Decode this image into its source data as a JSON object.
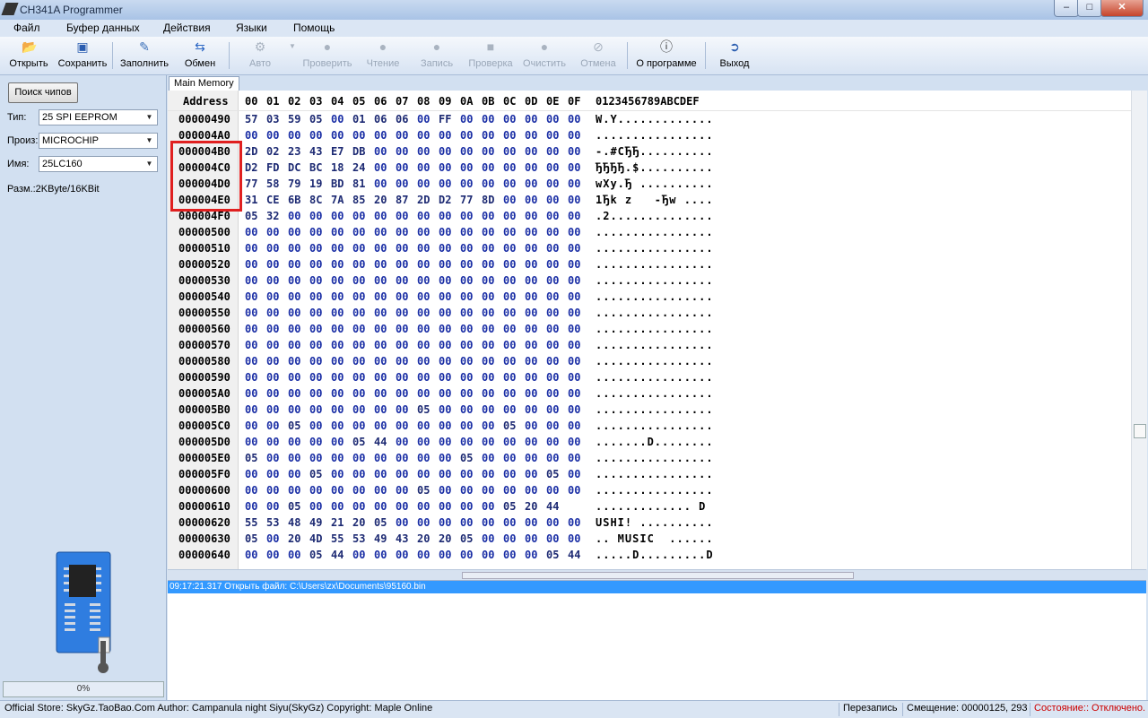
{
  "window": {
    "title": "CH341A Programmer",
    "btn_min": "–",
    "btn_max": "□",
    "btn_close": "✕"
  },
  "menu": [
    "Файл",
    "Буфер данных",
    "Действия",
    "Языки",
    "Помощь"
  ],
  "toolbar": [
    {
      "label": "Открыть",
      "icon": "open-folder-icon",
      "enabled": true
    },
    {
      "label": "Сохранить",
      "icon": "save-disk-icon",
      "enabled": true
    },
    {
      "label": "Заполнить",
      "icon": "fill-icon",
      "enabled": true
    },
    {
      "label": "Обмен",
      "icon": "swap-arrows-icon",
      "enabled": true
    },
    {
      "label": "Авто",
      "icon": "auto-icon",
      "enabled": false
    },
    {
      "label": "Проверить",
      "icon": "verify-icon",
      "enabled": false
    },
    {
      "label": "Чтение",
      "icon": "read-icon",
      "enabled": false
    },
    {
      "label": "Запись",
      "icon": "write-icon",
      "enabled": false
    },
    {
      "label": "Проверка",
      "icon": "check-icon",
      "enabled": false
    },
    {
      "label": "Очистить",
      "icon": "erase-icon",
      "enabled": false
    },
    {
      "label": "Отмена",
      "icon": "cancel-icon",
      "enabled": false
    },
    {
      "label": "О программе",
      "icon": "info-icon",
      "enabled": true
    },
    {
      "label": "Выход",
      "icon": "exit-icon",
      "enabled": true
    }
  ],
  "left": {
    "search_button": "Поиск чипов",
    "type_label": "Тип:",
    "type_value": "25 SPI EEPROM",
    "vendor_label": "Произ:",
    "vendor_value": "MICROCHIP",
    "name_label": "Имя:",
    "name_value": "25LC160",
    "size_text": "Разм.:2KByte/16KBit",
    "progress_text": "0%",
    "progress_fraction": 0
  },
  "hex": {
    "tab_label": "Main Memory",
    "header_address": "Address",
    "header_cols": [
      "00",
      "01",
      "02",
      "03",
      "04",
      "05",
      "06",
      "07",
      "08",
      "09",
      "0A",
      "0B",
      "0C",
      "0D",
      "0E",
      "0F"
    ],
    "header_ascii": "0123456789ABCDEF",
    "rows": [
      {
        "addr": "00000490",
        "bytes": [
          "57",
          "03",
          "59",
          "05",
          "00",
          "01",
          "06",
          "06",
          "00",
          "FF",
          "00",
          "00",
          "00",
          "00",
          "00",
          "00"
        ],
        "ascii": "W.Y............."
      },
      {
        "addr": "000004A0",
        "bytes": [
          "00",
          "00",
          "00",
          "00",
          "00",
          "00",
          "00",
          "00",
          "00",
          "00",
          "00",
          "00",
          "00",
          "00",
          "00",
          "00"
        ],
        "ascii": "................"
      },
      {
        "addr": "000004B0",
        "bytes": [
          "2D",
          "02",
          "23",
          "43",
          "E7",
          "DB",
          "00",
          "00",
          "00",
          "00",
          "00",
          "00",
          "00",
          "00",
          "00",
          "00"
        ],
        "ascii": "-.#CЂЂ.........."
      },
      {
        "addr": "000004C0",
        "bytes": [
          "D2",
          "FD",
          "DC",
          "BC",
          "18",
          "24",
          "00",
          "00",
          "00",
          "00",
          "00",
          "00",
          "00",
          "00",
          "00",
          "00"
        ],
        "ascii": "ЂЂЂЂ.$.........."
      },
      {
        "addr": "000004D0",
        "bytes": [
          "77",
          "58",
          "79",
          "19",
          "BD",
          "81",
          "00",
          "00",
          "00",
          "00",
          "00",
          "00",
          "00",
          "00",
          "00",
          "00"
        ],
        "ascii": "wXy.Ђ .........."
      },
      {
        "addr": "000004E0",
        "bytes": [
          "31",
          "CE",
          "6B",
          "8C",
          "7A",
          "85",
          "20",
          "87",
          "2D",
          "D2",
          "77",
          "8D",
          "00",
          "00",
          "00",
          "00"
        ],
        "ascii": "1Ђk z   -Ђw ...."
      },
      {
        "addr": "000004F0",
        "bytes": [
          "05",
          "32",
          "00",
          "00",
          "00",
          "00",
          "00",
          "00",
          "00",
          "00",
          "00",
          "00",
          "00",
          "00",
          "00",
          "00"
        ],
        "ascii": ".2.............."
      },
      {
        "addr": "00000500",
        "bytes": [
          "00",
          "00",
          "00",
          "00",
          "00",
          "00",
          "00",
          "00",
          "00",
          "00",
          "00",
          "00",
          "00",
          "00",
          "00",
          "00"
        ],
        "ascii": "................"
      },
      {
        "addr": "00000510",
        "bytes": [
          "00",
          "00",
          "00",
          "00",
          "00",
          "00",
          "00",
          "00",
          "00",
          "00",
          "00",
          "00",
          "00",
          "00",
          "00",
          "00"
        ],
        "ascii": "................"
      },
      {
        "addr": "00000520",
        "bytes": [
          "00",
          "00",
          "00",
          "00",
          "00",
          "00",
          "00",
          "00",
          "00",
          "00",
          "00",
          "00",
          "00",
          "00",
          "00",
          "00"
        ],
        "ascii": "................"
      },
      {
        "addr": "00000530",
        "bytes": [
          "00",
          "00",
          "00",
          "00",
          "00",
          "00",
          "00",
          "00",
          "00",
          "00",
          "00",
          "00",
          "00",
          "00",
          "00",
          "00"
        ],
        "ascii": "................"
      },
      {
        "addr": "00000540",
        "bytes": [
          "00",
          "00",
          "00",
          "00",
          "00",
          "00",
          "00",
          "00",
          "00",
          "00",
          "00",
          "00",
          "00",
          "00",
          "00",
          "00"
        ],
        "ascii": "................"
      },
      {
        "addr": "00000550",
        "bytes": [
          "00",
          "00",
          "00",
          "00",
          "00",
          "00",
          "00",
          "00",
          "00",
          "00",
          "00",
          "00",
          "00",
          "00",
          "00",
          "00"
        ],
        "ascii": "................"
      },
      {
        "addr": "00000560",
        "bytes": [
          "00",
          "00",
          "00",
          "00",
          "00",
          "00",
          "00",
          "00",
          "00",
          "00",
          "00",
          "00",
          "00",
          "00",
          "00",
          "00"
        ],
        "ascii": "................"
      },
      {
        "addr": "00000570",
        "bytes": [
          "00",
          "00",
          "00",
          "00",
          "00",
          "00",
          "00",
          "00",
          "00",
          "00",
          "00",
          "00",
          "00",
          "00",
          "00",
          "00"
        ],
        "ascii": "................"
      },
      {
        "addr": "00000580",
        "bytes": [
          "00",
          "00",
          "00",
          "00",
          "00",
          "00",
          "00",
          "00",
          "00",
          "00",
          "00",
          "00",
          "00",
          "00",
          "00",
          "00"
        ],
        "ascii": "................"
      },
      {
        "addr": "00000590",
        "bytes": [
          "00",
          "00",
          "00",
          "00",
          "00",
          "00",
          "00",
          "00",
          "00",
          "00",
          "00",
          "00",
          "00",
          "00",
          "00",
          "00"
        ],
        "ascii": "................"
      },
      {
        "addr": "000005A0",
        "bytes": [
          "00",
          "00",
          "00",
          "00",
          "00",
          "00",
          "00",
          "00",
          "00",
          "00",
          "00",
          "00",
          "00",
          "00",
          "00",
          "00"
        ],
        "ascii": "................"
      },
      {
        "addr": "000005B0",
        "bytes": [
          "00",
          "00",
          "00",
          "00",
          "00",
          "00",
          "00",
          "00",
          "05",
          "00",
          "00",
          "00",
          "00",
          "00",
          "00",
          "00"
        ],
        "ascii": "................"
      },
      {
        "addr": "000005C0",
        "bytes": [
          "00",
          "00",
          "05",
          "00",
          "00",
          "00",
          "00",
          "00",
          "00",
          "00",
          "00",
          "00",
          "05",
          "00",
          "00",
          "00"
        ],
        "ascii": "................"
      },
      {
        "addr": "000005D0",
        "bytes": [
          "00",
          "00",
          "00",
          "00",
          "00",
          "05",
          "44",
          "00",
          "00",
          "00",
          "00",
          "00",
          "00",
          "00",
          "00",
          "00"
        ],
        "ascii": ".......D........"
      },
      {
        "addr": "000005E0",
        "bytes": [
          "05",
          "00",
          "00",
          "00",
          "00",
          "00",
          "00",
          "00",
          "00",
          "00",
          "05",
          "00",
          "00",
          "00",
          "00",
          "00"
        ],
        "ascii": "................"
      },
      {
        "addr": "000005F0",
        "bytes": [
          "00",
          "00",
          "00",
          "05",
          "00",
          "00",
          "00",
          "00",
          "00",
          "00",
          "00",
          "00",
          "00",
          "00",
          "05",
          "00"
        ],
        "ascii": "................"
      },
      {
        "addr": "00000600",
        "bytes": [
          "00",
          "00",
          "00",
          "00",
          "00",
          "00",
          "00",
          "00",
          "05",
          "00",
          "00",
          "00",
          "00",
          "00",
          "00",
          "00"
        ],
        "ascii": "................"
      },
      {
        "addr": "00000610",
        "bytes": [
          "00",
          "00",
          "05",
          "00",
          "00",
          "00",
          "00",
          "00",
          "00",
          "00",
          "00",
          "00",
          "05",
          "20",
          "44"
        ],
        "ascii": "............. D"
      },
      {
        "addr": "00000620",
        "bytes": [
          "55",
          "53",
          "48",
          "49",
          "21",
          "20",
          "05",
          "00",
          "00",
          "00",
          "00",
          "00",
          "00",
          "00",
          "00",
          "00"
        ],
        "ascii": "USHI! .........."
      },
      {
        "addr": "00000630",
        "bytes": [
          "05",
          "00",
          "20",
          "4D",
          "55",
          "53",
          "49",
          "43",
          "20",
          "20",
          "05",
          "00",
          "00",
          "00",
          "00",
          "00"
        ],
        "ascii": ".. MUSIC  ......"
      },
      {
        "addr": "00000640",
        "bytes": [
          "00",
          "00",
          "00",
          "05",
          "44",
          "00",
          "00",
          "00",
          "00",
          "00",
          "00",
          "00",
          "00",
          "00",
          "05",
          "44"
        ],
        "ascii": ".....D.........D"
      }
    ]
  },
  "log": {
    "line": "09:17:21.317 Открыть файл: C:\\Users\\zx\\Documents\\95160.bin"
  },
  "status": {
    "store": "Official Store: SkyGz.TaoBao.Com Author: Campanula night Siyu(SkyGz) Copyright: Maple Online",
    "mode": "Перезапись",
    "offset": "Смещение: 00000125, 293",
    "state": "Состояние:: Отключено.",
    "state_color": "#cc0000"
  }
}
